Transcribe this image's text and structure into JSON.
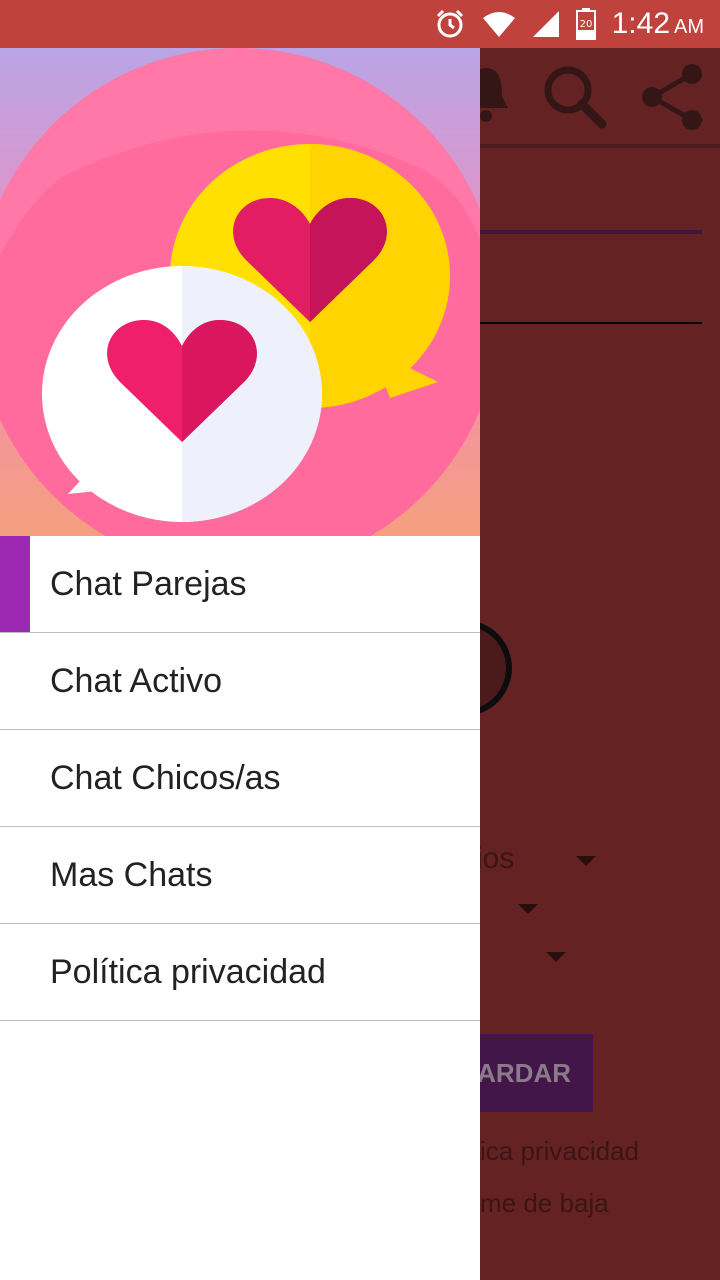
{
  "status_bar": {
    "time": "1:42",
    "ampm": "AM",
    "battery_level": "20",
    "icons": [
      "alarm-icon",
      "wifi-icon",
      "signal-icon",
      "battery-icon"
    ]
  },
  "toolbar": {
    "icons": [
      "bell-icon",
      "search-icon",
      "share-icon"
    ]
  },
  "background_form": {
    "dropdown_text_fragment": "ios",
    "button_label_fragment": "ARDAR",
    "link_privacy_fragment": "ica privacidad",
    "link_unsubscribe_fragment": "me de baja"
  },
  "drawer": {
    "header_image": "chat-hearts-logo",
    "items": [
      {
        "label": "Chat Parejas",
        "active": true
      },
      {
        "label": "Chat Activo",
        "active": false
      },
      {
        "label": "Chat Chicos/as",
        "active": false
      },
      {
        "label": "Mas Chats",
        "active": false
      },
      {
        "label": "Política privacidad",
        "active": false
      }
    ]
  },
  "colors": {
    "status_bar": "#c0423d",
    "scrim_background": "#652222",
    "active_indicator": "#9c27b0",
    "logo_pink": "#ff6699",
    "heart": "#e0195e",
    "yellow_bubble": "#ffdd00"
  }
}
